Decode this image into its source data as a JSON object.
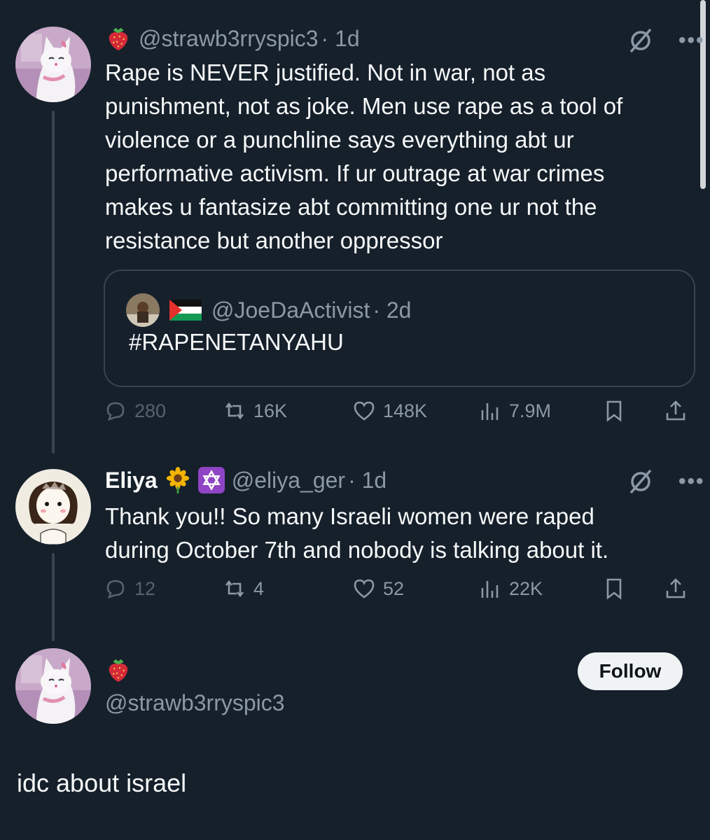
{
  "tweet1": {
    "handle": "@strawb3rryspic3",
    "time": "· 1d",
    "text": "Rape is NEVER justified. Not in war, not as\npunishment, not as joke. Men use rape as a tool of\nviolence or a punchline says everything abt ur\nperformative activism. If ur outrage at war crimes\nmakes u fantasize abt committing one ur not the\nresistance but another oppressor",
    "quote": {
      "handle": "@JoeDaActivist",
      "time": "· 2d",
      "text": "#RAPENETANYAHU"
    },
    "actions": {
      "replies": "280",
      "reposts": "16K",
      "likes": "148K",
      "views": "7.9M"
    }
  },
  "tweet2": {
    "name": "Eliya",
    "handle": "@eliya_ger",
    "time": "· 1d",
    "text": "Thank you!! So many Israeli women were raped\nduring October 7th and nobody is talking about it.",
    "actions": {
      "replies": "12",
      "reposts": "4",
      "likes": "52",
      "views": "22K"
    }
  },
  "tweet3": {
    "handle": "@strawb3rryspic3",
    "follow_label": "Follow",
    "text": "idc about israel"
  },
  "header_dots": "•••",
  "colors": {
    "background": "#15202b",
    "secondary_text": "#8b98a5",
    "border": "#38444d",
    "text": "#f7f9f9"
  },
  "icons": {
    "strawberry": "strawberry-emoji-icon",
    "sunflower": "sunflower-emoji-icon",
    "star_of_david": "star-of-david-emoji-icon",
    "flag": "palestine-flag-icon",
    "grok": "grok-icon",
    "more": "more-dots-icon",
    "reply": "reply-icon",
    "repost": "repost-icon",
    "like": "heart-icon",
    "views": "views-icon",
    "bookmark": "bookmark-icon",
    "share": "share-icon"
  }
}
